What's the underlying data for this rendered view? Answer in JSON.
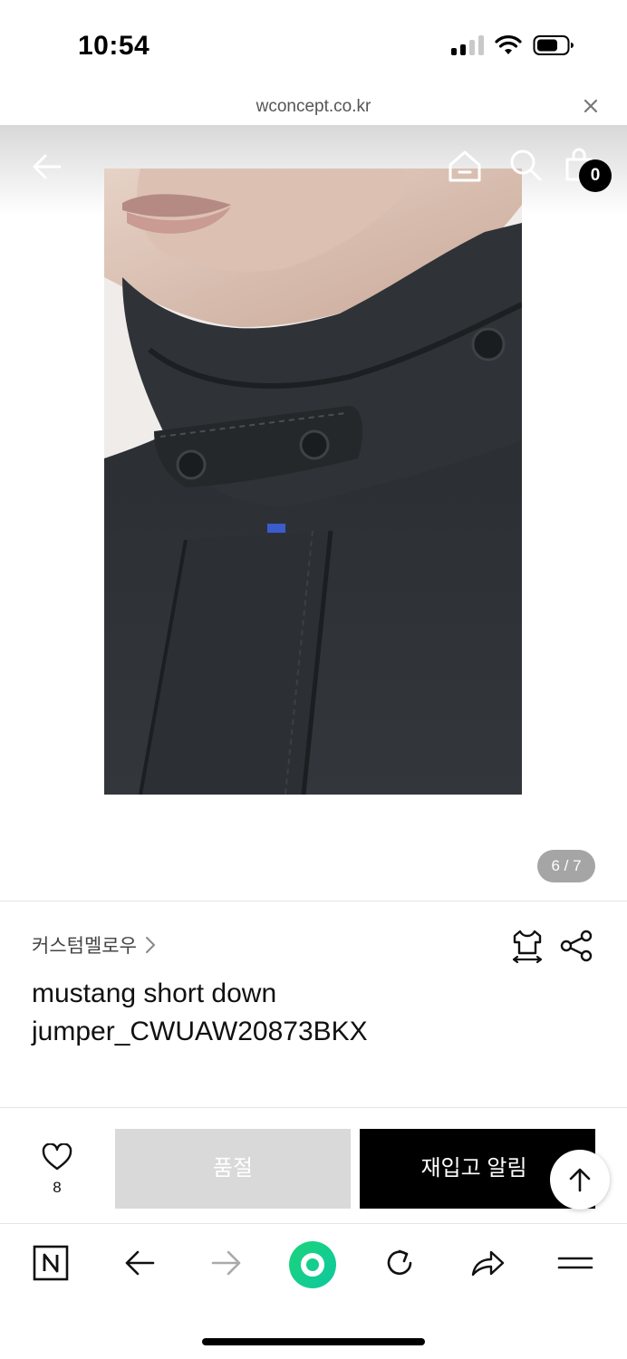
{
  "status_bar": {
    "time": "10:54"
  },
  "browser": {
    "url": "wconcept.co.kr"
  },
  "header": {
    "cart_count": "0"
  },
  "gallery": {
    "pager": "6 / 7"
  },
  "product": {
    "brand": "커스텀멜로우",
    "title": "mustang short down jumper_CWUAW20873BKX"
  },
  "buy_bar": {
    "likes": "8",
    "sold_out_label": "품절",
    "restock_label": "재입고 알림"
  }
}
